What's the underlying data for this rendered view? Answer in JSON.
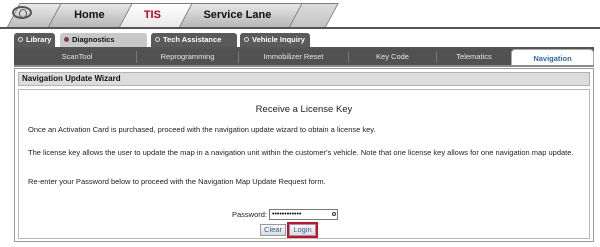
{
  "top_tabs": {
    "home": "Home",
    "tis": "TIS",
    "service_lane": "Service Lane"
  },
  "module_tabs": [
    {
      "label": "Library",
      "active": false
    },
    {
      "label": "Diagnostics",
      "active": true
    },
    {
      "label": "Tech Assistance",
      "active": false
    },
    {
      "label": "Vehicle Inquiry",
      "active": false
    }
  ],
  "sub_nav": [
    "ScanTool",
    "Reprogramming",
    "Immobilizer Reset",
    "Key Code",
    "Telematics",
    "Navigation"
  ],
  "wizard": {
    "header": "Navigation Update Wizard",
    "title": "Receive a License Key",
    "p1": "Once an Activation Card is purchased, proceed with the navigation update wizard to obtain a license key.",
    "p2": "The license key allows the user to update the map in a navigation unit within the customer's vehicle. Note that one license key allows for one navigation map update.",
    "p3": "Re-enter your Password below to proceed with the Navigation Map Update Request form.",
    "password_label": "Password:",
    "password_value": "••••••••••••",
    "clear_label": "Clear",
    "login_label": "Login"
  },
  "colors": {
    "accent_red": "#c8102e",
    "nav_blue": "#2a6ba8",
    "dark_bar": "#515151"
  }
}
